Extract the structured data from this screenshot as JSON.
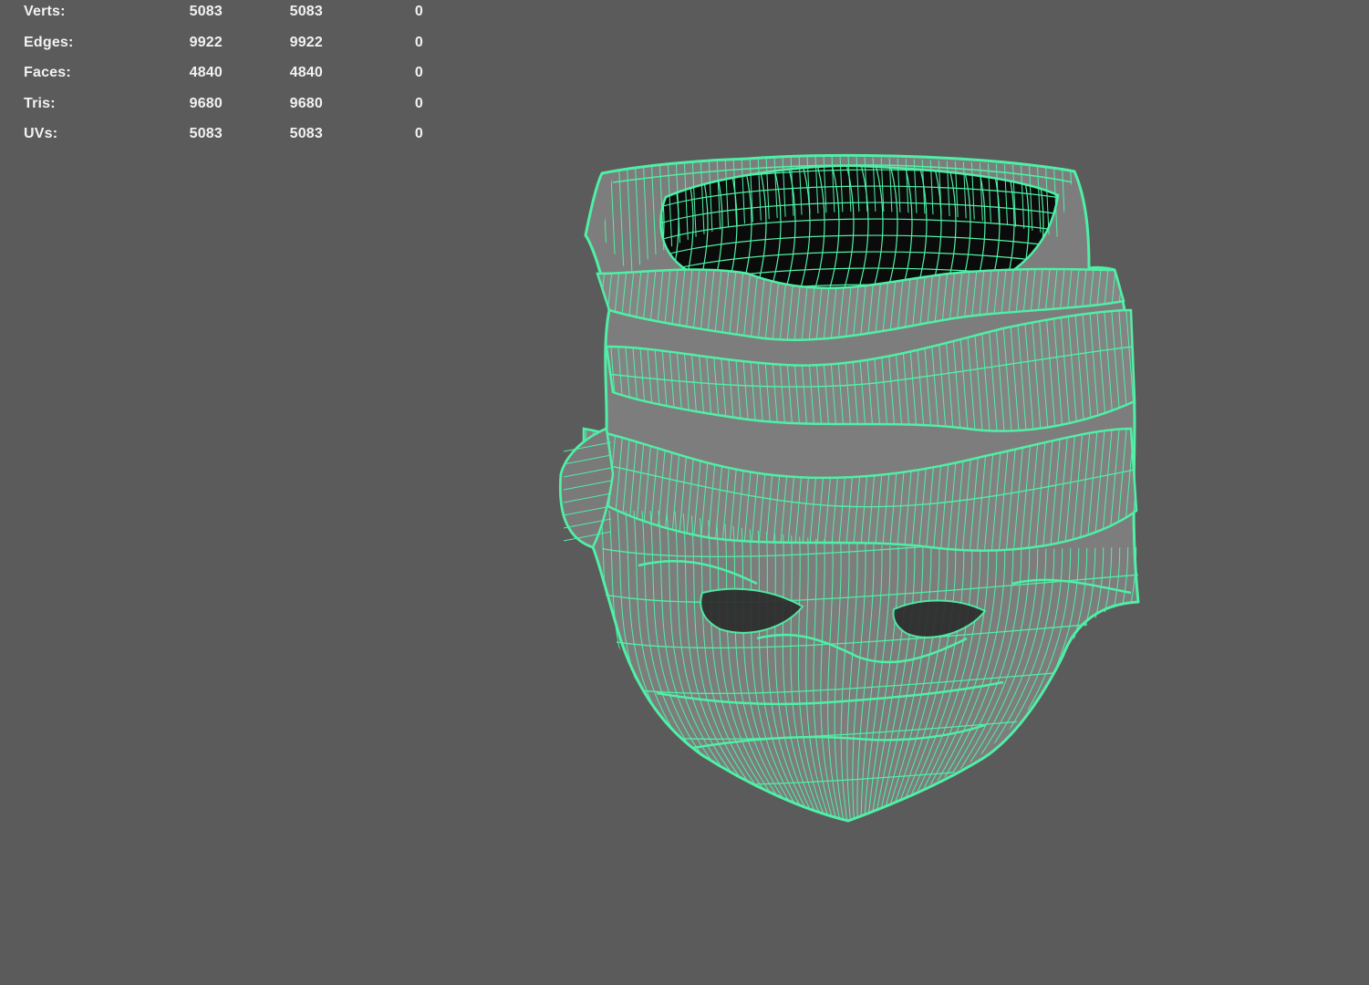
{
  "hud": {
    "rows": [
      {
        "label": "Verts:",
        "values": [
          "5083",
          "5083",
          "0"
        ]
      },
      {
        "label": "Edges:",
        "values": [
          "9922",
          "9922",
          "0"
        ]
      },
      {
        "label": "Faces:",
        "values": [
          "4840",
          "4840",
          "0"
        ]
      },
      {
        "label": "Tris:",
        "values": [
          "9680",
          "9680",
          "0"
        ]
      },
      {
        "label": "UVs:",
        "values": [
          "5083",
          "5083",
          "0"
        ]
      }
    ]
  },
  "colors": {
    "background": "#5b5b5b",
    "wireframe": "#4ff0a6",
    "surface": "#7d7d7d",
    "cavity": "#0b0b0b"
  },
  "viewport": {
    "object": "wireframe-head-mesh"
  }
}
